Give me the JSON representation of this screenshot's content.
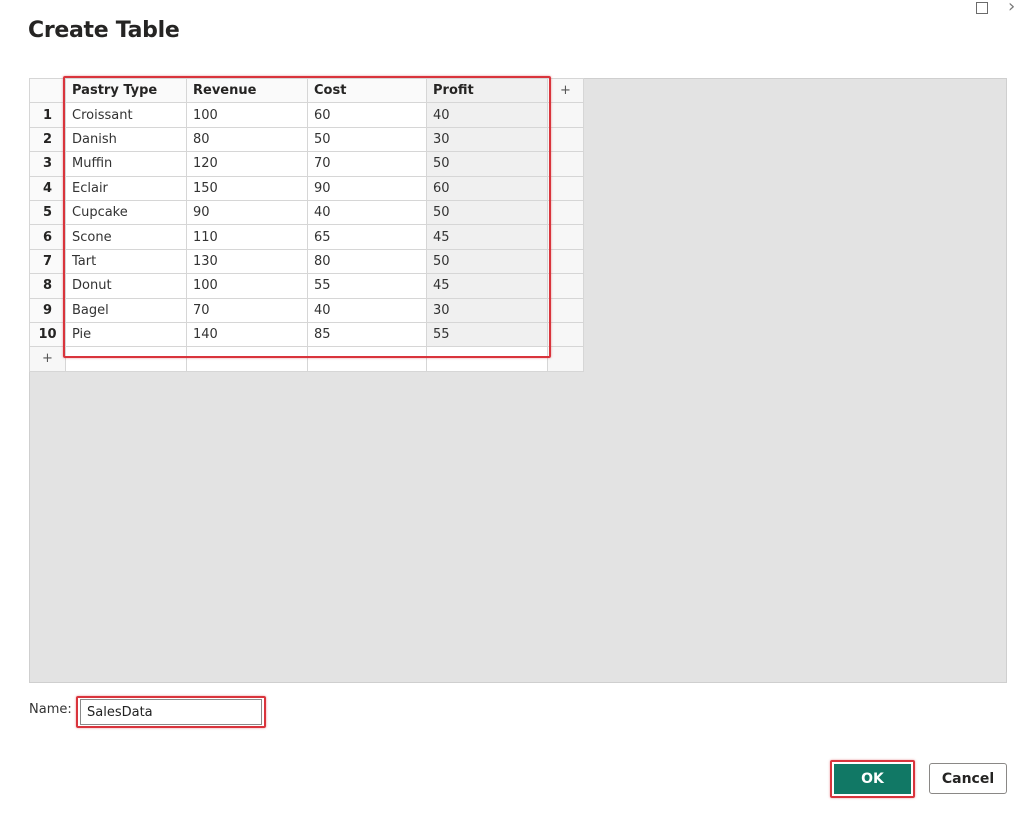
{
  "dialog": {
    "title": "Create Table"
  },
  "window_controls": {
    "maximize": "maximize-icon",
    "close": "close-icon"
  },
  "table": {
    "headers": [
      "Pastry Type",
      "Revenue",
      "Cost",
      "Profit"
    ],
    "add_column_label": "+",
    "add_row_label": "+",
    "rows": [
      {
        "num": "1",
        "cells": [
          "Croissant",
          "100",
          "60",
          "40"
        ]
      },
      {
        "num": "2",
        "cells": [
          "Danish",
          "80",
          "50",
          "30"
        ]
      },
      {
        "num": "3",
        "cells": [
          "Muffin",
          "120",
          "70",
          "50"
        ]
      },
      {
        "num": "4",
        "cells": [
          "Eclair",
          "150",
          "90",
          "60"
        ]
      },
      {
        "num": "5",
        "cells": [
          "Cupcake",
          "90",
          "40",
          "50"
        ]
      },
      {
        "num": "6",
        "cells": [
          "Scone",
          "110",
          "65",
          "45"
        ]
      },
      {
        "num": "7",
        "cells": [
          "Tart",
          "130",
          "80",
          "50"
        ]
      },
      {
        "num": "8",
        "cells": [
          "Donut",
          "100",
          "55",
          "45"
        ]
      },
      {
        "num": "9",
        "cells": [
          "Bagel",
          "70",
          "40",
          "30"
        ]
      },
      {
        "num": "10",
        "cells": [
          "Pie",
          "140",
          "85",
          "55"
        ]
      }
    ]
  },
  "name_field": {
    "label": "Name:",
    "value": "SalesData"
  },
  "buttons": {
    "ok": "OK",
    "cancel": "Cancel"
  },
  "colors": {
    "accent": "#117865",
    "highlight": "#d9343c"
  }
}
